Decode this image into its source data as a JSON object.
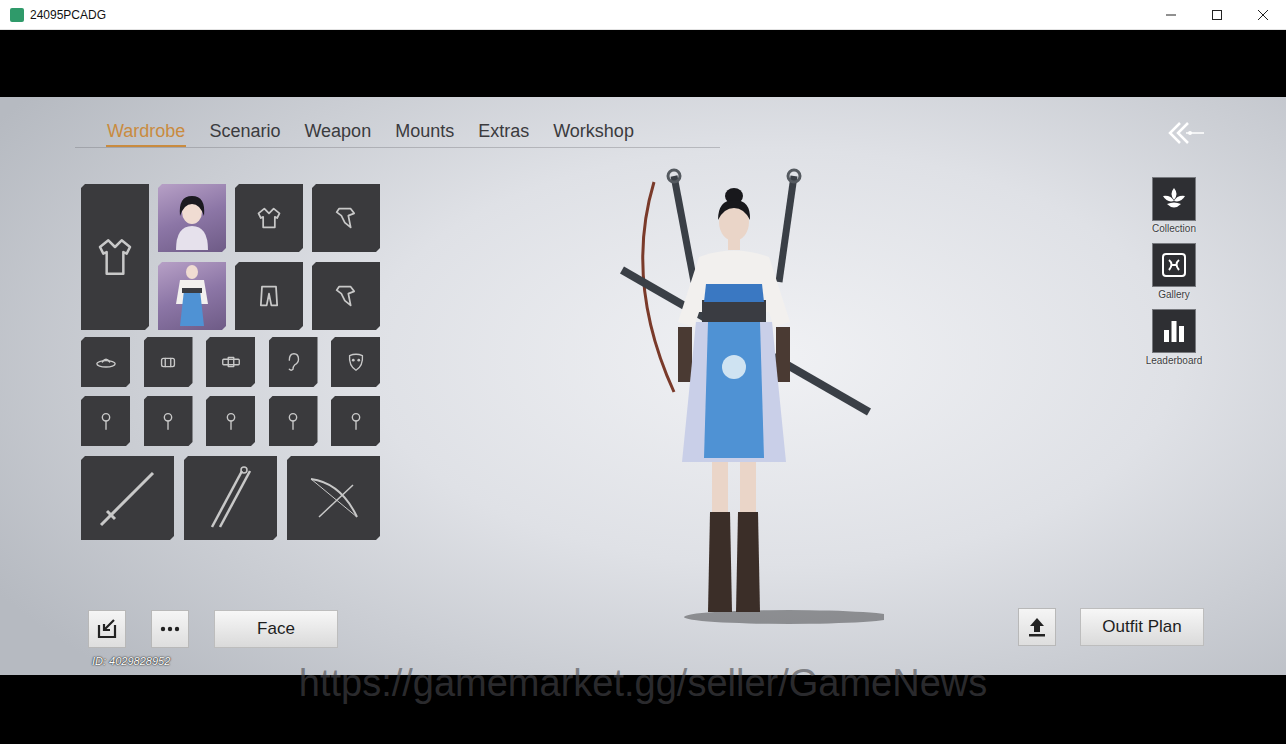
{
  "window": {
    "title": "24095PCADG"
  },
  "tabs": [
    {
      "label": "Wardrobe",
      "selected": true
    },
    {
      "label": "Scenario",
      "selected": false
    },
    {
      "label": "Weapon",
      "selected": false
    },
    {
      "label": "Mounts",
      "selected": false
    },
    {
      "label": "Extras",
      "selected": false
    },
    {
      "label": "Workshop",
      "selected": false
    }
  ],
  "wardrobe": {
    "slots": [
      {
        "kind": "robe"
      },
      {
        "kind": "portrait"
      },
      {
        "kind": "top"
      },
      {
        "kind": "accessory"
      },
      {
        "kind": "outfit"
      },
      {
        "kind": "pants"
      },
      {
        "kind": "accessory"
      },
      {
        "kind": "hat"
      },
      {
        "kind": "bracer"
      },
      {
        "kind": "belt"
      },
      {
        "kind": "ear"
      },
      {
        "kind": "mask"
      },
      {
        "kind": "pin"
      },
      {
        "kind": "pin"
      },
      {
        "kind": "pin"
      },
      {
        "kind": "pin"
      },
      {
        "kind": "pin"
      },
      {
        "kind": "sword"
      },
      {
        "kind": "twin-swords"
      },
      {
        "kind": "bow"
      }
    ]
  },
  "side_buttons": [
    {
      "label": "Collection",
      "kind": "collection"
    },
    {
      "label": "Gallery",
      "kind": "gallery"
    },
    {
      "label": "Leaderboard",
      "kind": "leaderboard"
    }
  ],
  "bottom_left": {
    "face_button": "Face",
    "id": "ID: 4029828952"
  },
  "bottom_right": {
    "outfit_plan_button": "Outfit Plan"
  },
  "watermark": "https://gamemarket.gg/seller/GameNews"
}
